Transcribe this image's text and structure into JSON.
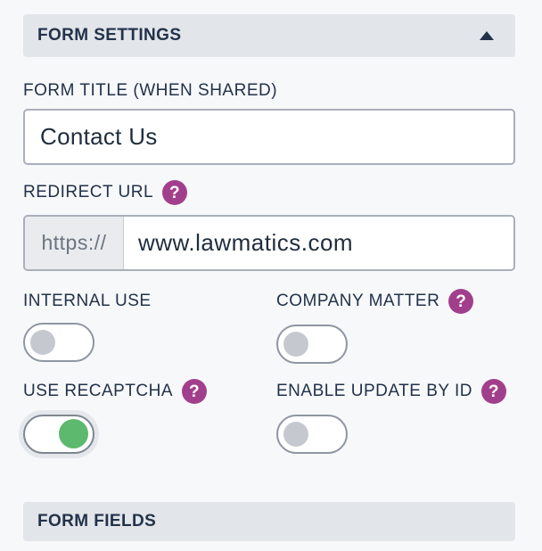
{
  "form_settings": {
    "header": "FORM SETTINGS",
    "collapse_icon": "caret-up-icon"
  },
  "form_title": {
    "label": "FORM TITLE (WHEN SHARED)",
    "value": "Contact Us"
  },
  "redirect_url": {
    "label": "REDIRECT URL",
    "help_icon": "question-icon",
    "prefix": "https://",
    "value": "www.lawmatics.com"
  },
  "toggles": {
    "internal_use": {
      "label": "INTERNAL USE",
      "on": false
    },
    "company_matter": {
      "label": "COMPANY MATTER",
      "on": false
    },
    "use_recaptcha": {
      "label": "USE RECAPTCHA",
      "on": true
    },
    "enable_update_by_id": {
      "label": "ENABLE UPDATE BY ID",
      "on": false
    }
  },
  "help_glyph": "?",
  "form_fields": {
    "header": "FORM FIELDS"
  },
  "colors": {
    "accent_help": "#a23f8c",
    "toggle_on": "#5cb96e",
    "toggle_off_knob": "#c5c9cf",
    "section_bg": "#e2e5e9"
  }
}
